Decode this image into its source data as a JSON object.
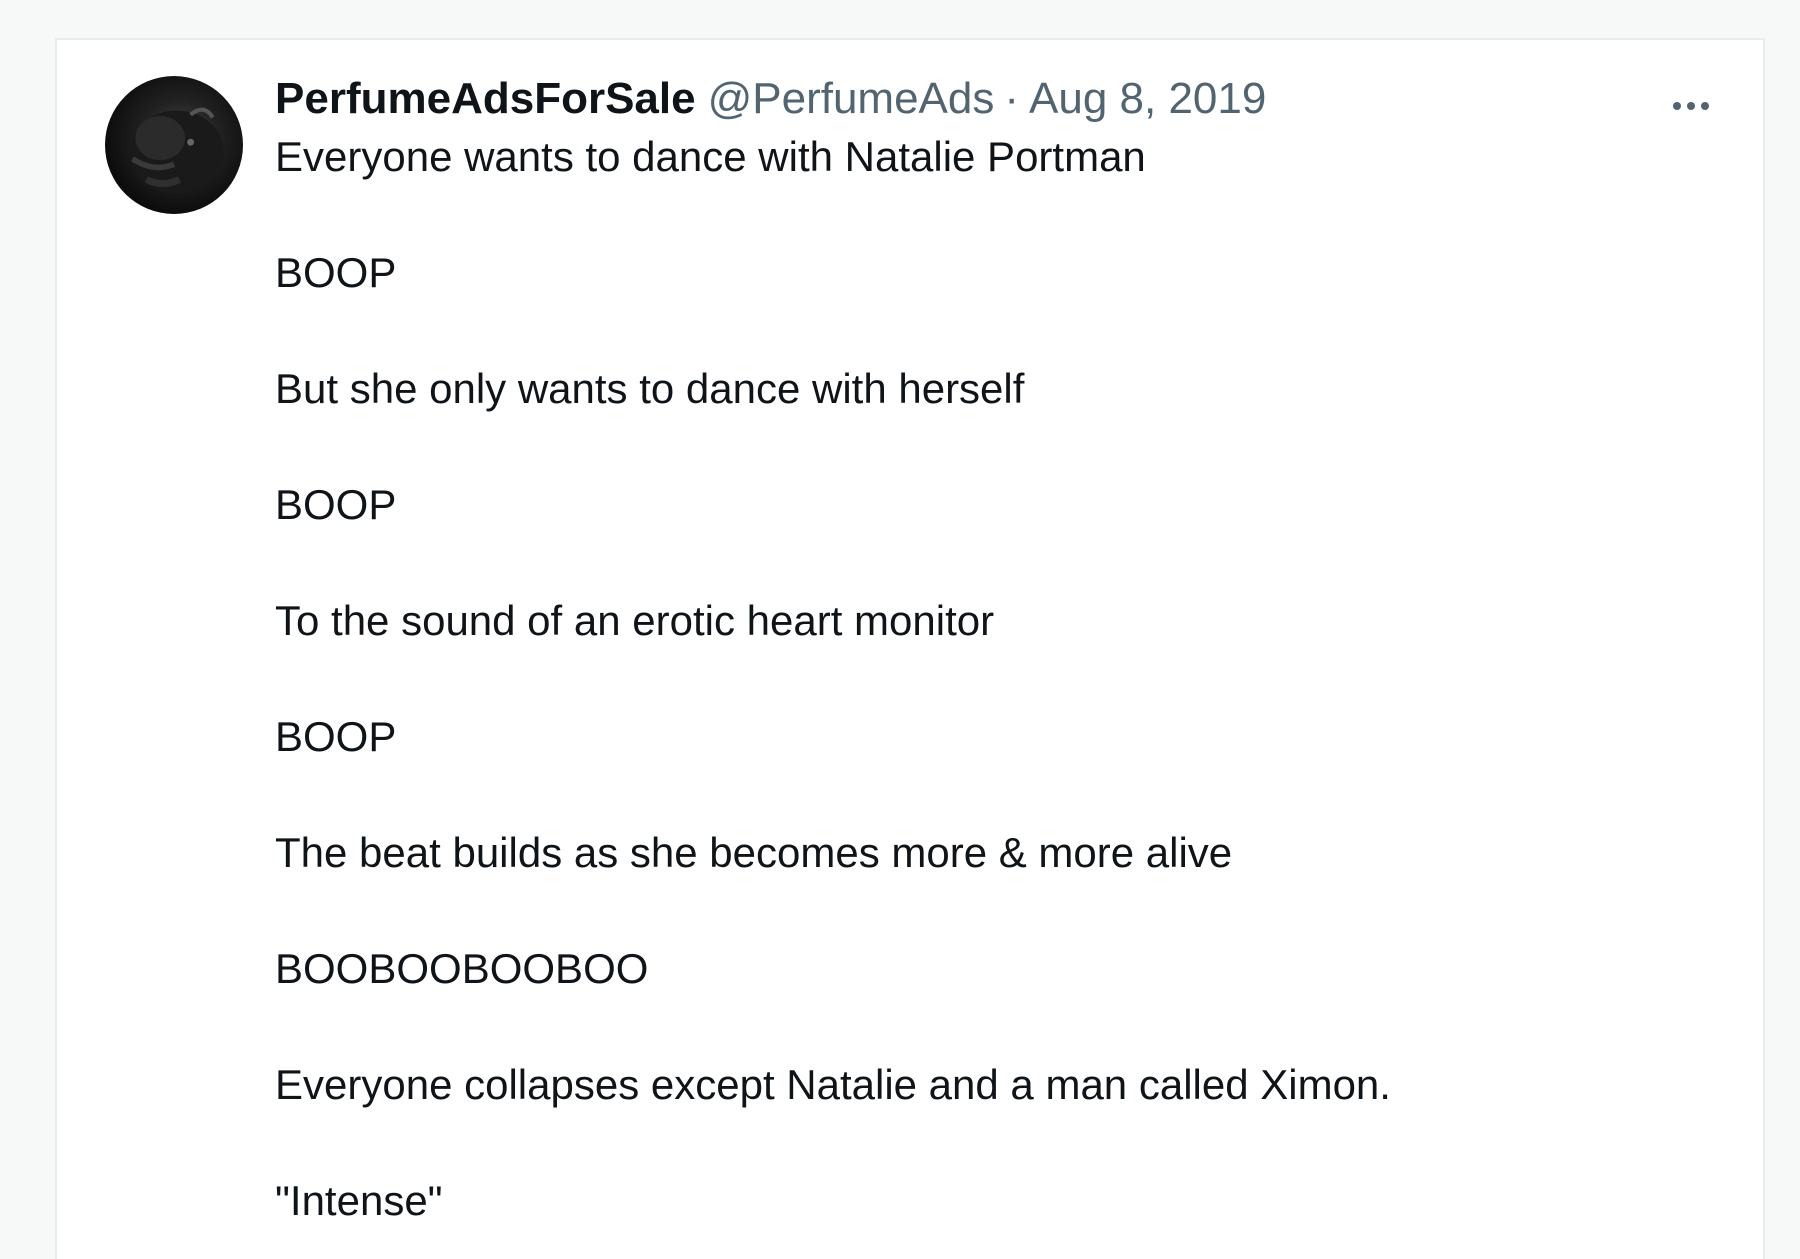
{
  "tweet": {
    "display_name": "PerfumeAdsForSale",
    "handle": "@PerfumeAds",
    "separator": "·",
    "date": "Aug 8, 2019",
    "more_icon": "more-horizontal-icon",
    "avatar_icon": "bison-avatar",
    "lines": [
      "Everyone wants to dance with Natalie Portman",
      "BOOP",
      "But she only wants to dance with herself",
      "BOOP",
      "To the sound of an erotic heart monitor",
      "BOOP",
      "The beat builds as she becomes more & more alive",
      "BOOBOOBOOBOO",
      "Everyone collapses except Natalie and a man called Ximon.",
      "\"Intense\""
    ]
  },
  "colors": {
    "text_primary": "#0f1419",
    "text_secondary": "#536471",
    "border": "#e6ecf0"
  }
}
